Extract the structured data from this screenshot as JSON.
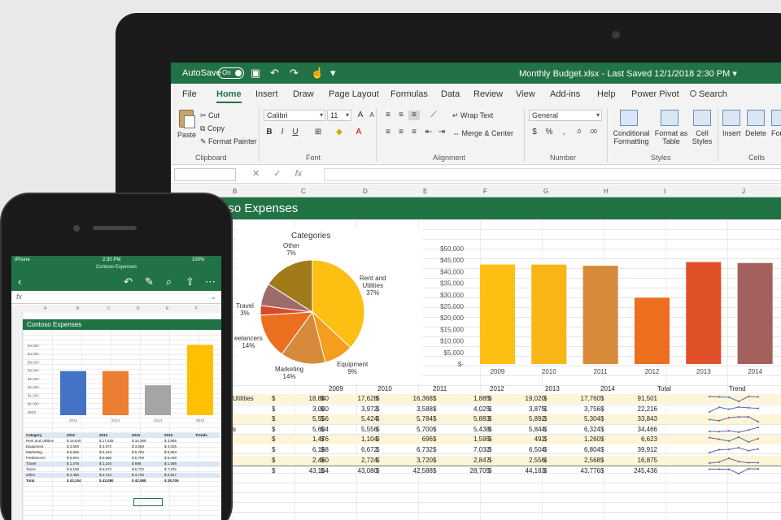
{
  "window": {
    "autosave_label": "AutoSave",
    "autosave_state": "On",
    "doc_title": "Monthly Budget.xlsx  -  Last Saved 12/1/2018 2:30 PM  ▾"
  },
  "ribbon_tabs": [
    {
      "label": "File"
    },
    {
      "label": "Home"
    },
    {
      "label": "Insert"
    },
    {
      "label": "Draw"
    },
    {
      "label": "Page Layout"
    },
    {
      "label": "Formulas"
    },
    {
      "label": "Data"
    },
    {
      "label": "Review"
    },
    {
      "label": "View"
    },
    {
      "label": "Add-ins"
    },
    {
      "label": "Help"
    },
    {
      "label": "Power Pivot"
    },
    {
      "label": "Search"
    }
  ],
  "active_tab": "Home",
  "ribbon": {
    "paste": "Paste",
    "cut": "Cut",
    "copy": "Copy",
    "format_painter": "Format Painter",
    "clipboard_group": "Clipboard",
    "font_name": "Calibri",
    "font_size": "11",
    "font_group": "Font",
    "wrap_text": "Wrap Text",
    "merge_center": "Merge & Center",
    "alignment_group": "Alignment",
    "number_format": "General",
    "number_group": "Number",
    "conditional_formatting": "Conditional Formatting",
    "format_as_table": "Format as Table",
    "cell_styles": "Cell Styles",
    "styles_group": "Styles",
    "insert": "Insert",
    "delete": "Delete",
    "format": "Form",
    "cells_group": "Cells"
  },
  "column_letters": [
    "B",
    "C",
    "D",
    "E",
    "F",
    "G",
    "H",
    "I",
    "J"
  ],
  "sheet": {
    "banner_title": "oso Expenses"
  },
  "pie": {
    "title": "Categories",
    "slices": [
      {
        "name": "Rent and Utilities",
        "percent": 37,
        "color": "#fcbf12"
      },
      {
        "name": "Equipment",
        "percent": 9,
        "color": "#f59d1c"
      },
      {
        "name": "Marketing",
        "percent": 14,
        "color": "#d68a3a"
      },
      {
        "name": "Freelancers",
        "percent": 14,
        "color": "#ec6f1f"
      },
      {
        "name": "Travel",
        "percent": 3,
        "color": "#d84a26"
      },
      {
        "name": "Other",
        "percent": 7,
        "color": "#9e6b6b"
      },
      {
        "name": "",
        "percent": 16,
        "color": "#a17b1a"
      }
    ],
    "labels": {
      "rent": "Rent and\nUtilities\n37%",
      "equipment": "Equipment\n9%",
      "marketing": "Marketing\n14%",
      "freelancers": "eelancers\n14%",
      "travel": "Travel\n3%",
      "other": "Other\n7%"
    }
  },
  "chart_data": {
    "type": "bar",
    "categories": [
      "2009",
      "2010",
      "2011",
      "2012",
      "2013",
      "2014"
    ],
    "values": [
      43104,
      43080,
      42588,
      28705,
      44183,
      43776
    ],
    "colors": [
      "#fcbf12",
      "#f7b516",
      "#d68a3a",
      "#ec6f1f",
      "#e0512a",
      "#a2615c"
    ],
    "ytick_labels": [
      "$-",
      "$5,000",
      "$10,000",
      "$15,000",
      "$20,000",
      "$25,000",
      "$30,000",
      "$35,000",
      "$40,000",
      "$45,000",
      "$50,000"
    ],
    "ylim": [
      0,
      50000
    ],
    "grid": false
  },
  "table": {
    "headers": [
      "2009",
      "2010",
      "2011",
      "2012",
      "2013",
      "2014",
      "Total",
      "Trend"
    ],
    "rows": [
      {
        "label": "Utilities",
        "vals": [
          "18,840",
          "17,628",
          "16,368",
          "1,885",
          "19,020",
          "17,760",
          "91,501"
        ]
      },
      {
        "label": "",
        "vals": [
          "3,000",
          "3,972",
          "3,588",
          "4,025",
          "3,875",
          "3,756",
          "22,216"
        ]
      },
      {
        "label": "",
        "vals": [
          "5,556",
          "5,424",
          "5,784",
          "5,883",
          "5,892",
          "5,304",
          "33,843"
        ]
      },
      {
        "label": "s",
        "vals": [
          "5,604",
          "5,556",
          "5,700",
          "5,438",
          "5,844",
          "6,324",
          "34,466"
        ]
      },
      {
        "label": "",
        "vals": [
          "1,476",
          "1,104",
          "696",
          "1,595",
          "492",
          "1,260",
          "6,623"
        ]
      },
      {
        "label": "",
        "vals": [
          "6,168",
          "6,672",
          "6,732",
          "7,032",
          "6,504",
          "6,804",
          "39,912"
        ]
      },
      {
        "label": "",
        "vals": [
          "2,460",
          "2,724",
          "3,720",
          "2,847",
          "2,556",
          "2,568",
          "16,875"
        ]
      },
      {
        "label": "",
        "vals": [
          "43,104",
          "43,080",
          "42,588",
          "28,705",
          "44,183",
          "43,776",
          "245,436"
        ]
      }
    ],
    "currency": "$"
  },
  "phone": {
    "carrier": "iPhone",
    "time": "2:30 PM",
    "battery": "100%",
    "doc_title": "Contoso Expenses",
    "banner": "Contoso Expenses",
    "col_letters": [
      "A",
      "B",
      "C",
      "D",
      "E",
      "F"
    ],
    "chart_ticks": [
      "$4,500",
      "$4,000",
      "$3,500",
      "$3,000",
      "$2,500",
      "$2,000",
      "$1,500",
      "$1,000",
      "$500"
    ],
    "chart_bars": [
      {
        "year": "2013",
        "value": 2950,
        "color": "#4472c4"
      },
      {
        "year": "2014",
        "value": 2950,
        "color": "#ed7d31"
      },
      {
        "year": "2014",
        "value": 2000,
        "color": "#a5a5a5"
      },
      {
        "year": "2015",
        "value": 4700,
        "color": "#ffc000"
      }
    ],
    "table_header": [
      "Category",
      "2012",
      "2013",
      "2014",
      "2015",
      "Trends"
    ],
    "table_rows": [
      [
        "Rent and Utilities",
        "$ 19,840",
        "$ 17,628",
        "$ 16,368",
        "$ 3,885"
      ],
      [
        "Equipment",
        "$ 3,000",
        "$ 3,972",
        "$ 3,588",
        "$ 4,025"
      ],
      [
        "Marketing",
        "$ 5,556",
        "$ 5,424",
        "$ 5,784",
        "$ 5,883"
      ],
      [
        "Freelancers",
        "$ 5,604",
        "$ 5,556",
        "$ 5,700",
        "$ 5,438"
      ],
      [
        "Travel",
        "$ 1,476",
        "$ 1,104",
        "$ 696",
        "$ 1,595"
      ],
      [
        "Taxes",
        "$ 6,168",
        "$ 6,672",
        "$ 6,732",
        "$ 7,032"
      ],
      [
        "Other",
        "$ 2,460",
        "$ 2,724",
        "$ 3,720",
        "$ 2,847"
      ],
      [
        "Total",
        "$ 43,104",
        "$ 43,080",
        "$ 42,588",
        "$ 28,705"
      ]
    ]
  }
}
